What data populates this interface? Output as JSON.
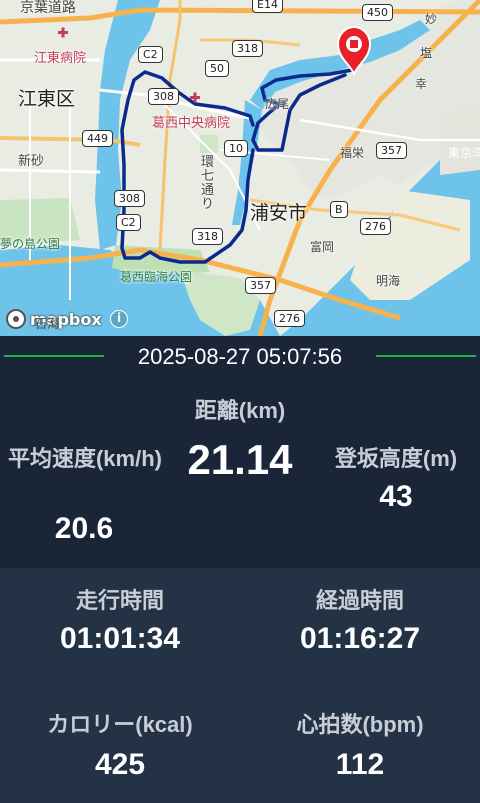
{
  "map": {
    "labels": {
      "koto_ku": "江東区",
      "urayasu": "浦安市",
      "koto_hospital": "江東病院",
      "kasai_hospital": "葛西中央病院",
      "yumenoshima": "夢の島公園",
      "kasai_park": "葛西臨海公園",
      "shinsuna": "新砂",
      "kanshichi": "環七通り",
      "hiroo": "広尾",
      "fukuei": "福栄",
      "tomioka": "富岡",
      "akemi": "明海",
      "higashi_nagisa": "東京湾",
      "myo": "妙",
      "shiomi": "塩",
      "saiwai": "幸",
      "keiyo": "京葉道路"
    },
    "route_badges": [
      "450",
      "E14",
      "318",
      "50",
      "C2",
      "308",
      "449",
      "10",
      "357",
      "B",
      "276",
      "308",
      "C2",
      "318",
      "357",
      "276",
      "450"
    ],
    "attribution": {
      "logo_text": "mapbox",
      "info_symbol": "i",
      "overlay_text": "石海"
    },
    "marker_color": "#e8202a",
    "route_color": "#0a2a8c"
  },
  "recorded_at": "2025-08-27 05:07:56",
  "stats": {
    "distance": {
      "label": "距離(km)",
      "value": "21.14"
    },
    "avg_speed": {
      "label": "平均速度(km/h)",
      "value": "20.6"
    },
    "elevation": {
      "label": "登坂高度(m)",
      "value": "43"
    },
    "moving_time": {
      "label": "走行時間",
      "value": "01:01:34"
    },
    "elapsed_time": {
      "label": "経過時間",
      "value": "01:16:27"
    },
    "calories": {
      "label": "カロリー(kcal)",
      "value": "425"
    },
    "heart_rate": {
      "label": "心拍数(bpm)",
      "value": "112"
    }
  },
  "colors": {
    "accent_line": "#1db546",
    "panel_dark": "#1a2538",
    "panel_light": "#243246"
  }
}
